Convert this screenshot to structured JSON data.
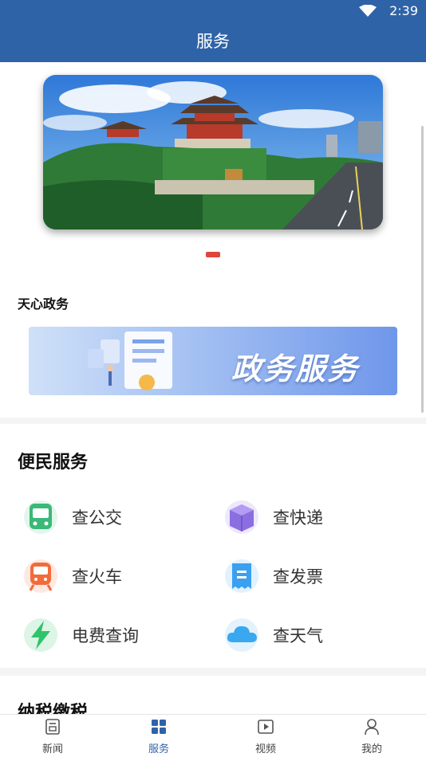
{
  "status": {
    "time": "2:39"
  },
  "header": {
    "title": "服务"
  },
  "gov": {
    "title": "天心政务",
    "banner_text": "政务服务"
  },
  "convenience": {
    "title": "便民服务",
    "items": [
      {
        "label": "查公交",
        "icon": "bus-icon"
      },
      {
        "label": "查快递",
        "icon": "package-icon"
      },
      {
        "label": "查火车",
        "icon": "train-icon"
      },
      {
        "label": "查发票",
        "icon": "invoice-icon"
      },
      {
        "label": "电费查询",
        "icon": "lightning-icon"
      },
      {
        "label": "查天气",
        "icon": "cloud-icon"
      }
    ]
  },
  "tax": {
    "title": "纳税缴税"
  },
  "tabs": [
    {
      "label": "新闻",
      "icon": "news-icon",
      "active": false
    },
    {
      "label": "服务",
      "icon": "grid-icon",
      "active": true
    },
    {
      "label": "视频",
      "icon": "video-icon",
      "active": false
    },
    {
      "label": "我的",
      "icon": "user-icon",
      "active": false
    }
  ],
  "colors": {
    "primary": "#2f63a8",
    "accent_red": "#e0453c",
    "bus_green": "#3cb878",
    "bolt_green": "#2fc36a",
    "train_orange": "#f26b3a",
    "cloud_blue": "#3aa8f0"
  }
}
